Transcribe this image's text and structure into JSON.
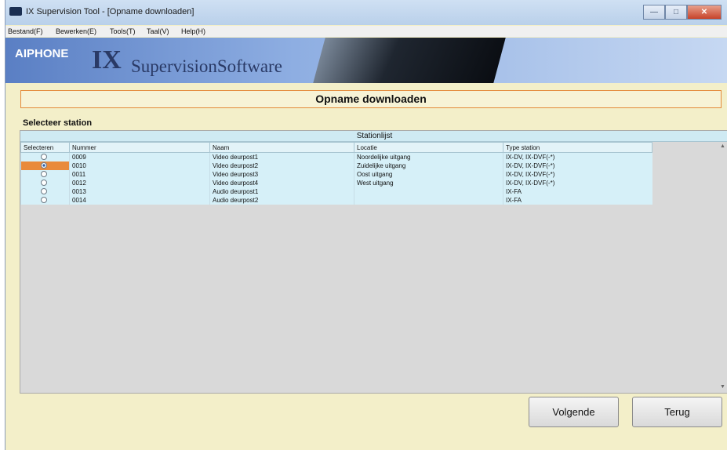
{
  "window": {
    "title": "IX Supervision Tool - [Opname downloaden]"
  },
  "menu": [
    "Bestand(F)",
    "Bewerken(E)",
    "Tools(T)",
    "Taal(V)",
    "Help(H)"
  ],
  "banner": {
    "logo": "AIPHONE",
    "ix": "IX",
    "software": "SupervisionSoftware"
  },
  "screen_title": "Opname downloaden",
  "section_label": "Selecteer station",
  "list": {
    "caption": "Stationlijst",
    "columns": [
      "Selecteren",
      "Nummer",
      "Naam",
      "Locatie",
      "Type station"
    ],
    "selected_index": 1,
    "rows": [
      {
        "nummer": "0009",
        "naam": "Video deurpost1",
        "locatie": "Noordelijke uitgang",
        "type": "IX-DV, IX-DVF(-*)"
      },
      {
        "nummer": "0010",
        "naam": "Video deurpost2",
        "locatie": "Zuidelijke uitgang",
        "type": "IX-DV, IX-DVF(-*)"
      },
      {
        "nummer": "0011",
        "naam": "Video deurpost3",
        "locatie": "Oost uitgang",
        "type": "IX-DV, IX-DVF(-*)"
      },
      {
        "nummer": "0012",
        "naam": "Video deurpost4",
        "locatie": "West uitgang",
        "type": "IX-DV, IX-DVF(-*)"
      },
      {
        "nummer": "0013",
        "naam": "Audio deurpost1",
        "locatie": "",
        "type": "IX-FA"
      },
      {
        "nummer": "0014",
        "naam": "Audio deurpost2",
        "locatie": "",
        "type": "IX-FA"
      }
    ]
  },
  "buttons": {
    "next": "Volgende",
    "back": "Terug"
  },
  "colors": {
    "accent": "#e98a3a",
    "panel": "#f3efc9",
    "list_bg": "#d6f0f8"
  }
}
